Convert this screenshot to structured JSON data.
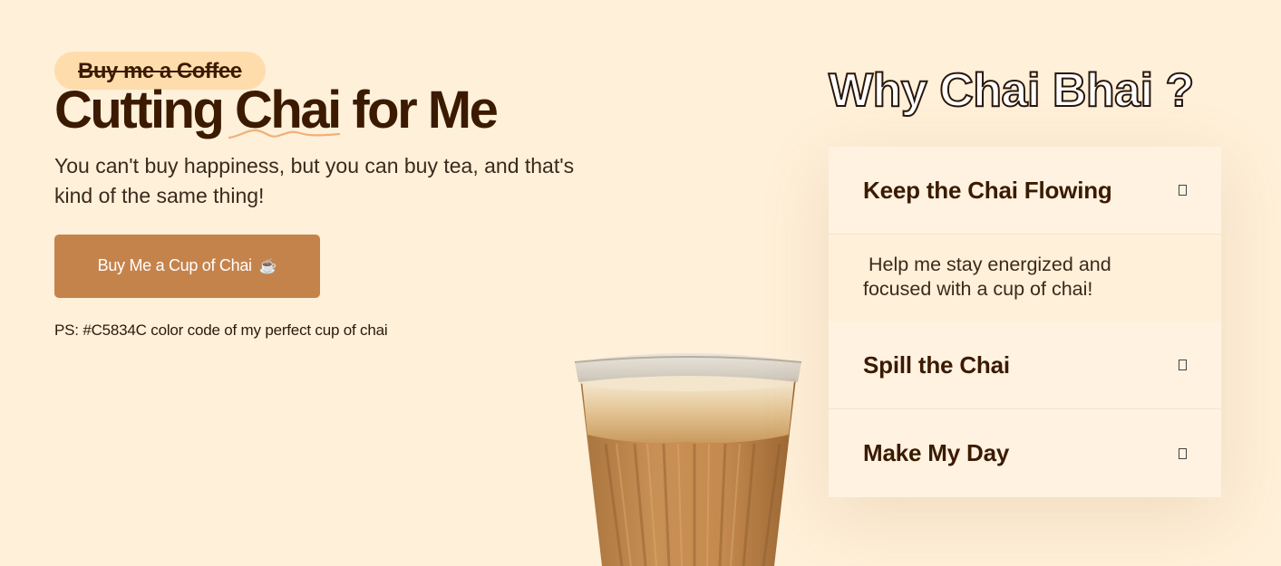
{
  "hero": {
    "badge_text": "Buy me a Coffee",
    "headline_pre": "Cutting ",
    "headline_highlight": "Chai",
    "headline_post": " for Me",
    "subtitle": "You can't buy happiness, but you can buy tea, and that's kind of the same thing!",
    "cta_label": "Buy Me a Cup of Chai",
    "cta_icon": "☕",
    "ps_note": "PS: #C5834C color code of my perfect cup of chai"
  },
  "why": {
    "title": "Why Chai Bhai ?",
    "items": [
      {
        "title": "Keep the Chai Flowing",
        "body": " Help me stay energized and focused with a cup of chai!",
        "open": true
      },
      {
        "title": "Spill the Chai",
        "open": false
      },
      {
        "title": "Make My Day",
        "open": false
      }
    ]
  },
  "colors": {
    "background": "#fff0d9",
    "badge": "#ffdcac",
    "brand_chai": "#c5834c",
    "headline": "#3b1a00",
    "squiggle": "#f0b07a"
  },
  "icons": {
    "cta_icon": "hot-beverage-icon",
    "accordion_toggle": "toggle-icon",
    "illustration": "chai-glass-icon"
  }
}
